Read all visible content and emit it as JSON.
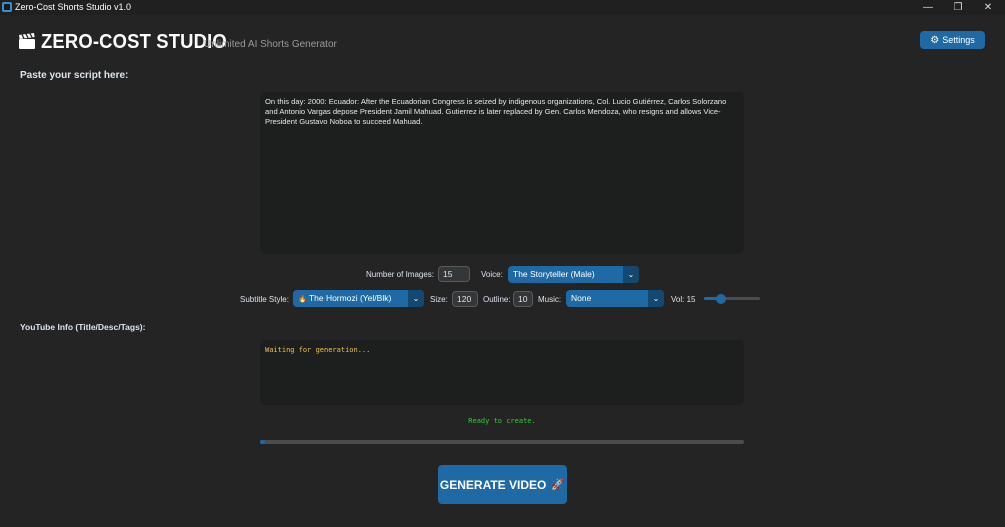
{
  "window": {
    "title": "Zero-Cost Shorts Studio v1.0",
    "min_glyph": "—",
    "restore_glyph": "❐",
    "close_glyph": "✕"
  },
  "header": {
    "brand": "ZERO-COST STUDIO",
    "tagline": "Unlimited AI Shorts Generator",
    "settings_label": "Settings",
    "settings_icon": "gear-icon",
    "logo_icon": "clapperboard-icon"
  },
  "script": {
    "label": "Paste your script here:",
    "text": "On this day: 2000: Ecuador: After the Ecuadorian Congress is seized by indigenous organizations, Col. Lucio Gutiérrez, Carlos Solorzano and Antonio Vargas depose President Jamil Mahuad. Gutierrez is later replaced by Gen. Carlos Mendoza, who resigns and allows Vice-President Gustavo Noboa to succeed Mahuad."
  },
  "controls": {
    "num_images_label": "Number of Images:",
    "num_images_value": "15",
    "voice_label": "Voice:",
    "voice_value": "The Storyteller (Male)",
    "subtitle_label": "Subtitle Style:",
    "subtitle_value": "The Hormozi (Yel/Blk)",
    "subtitle_icon": "fire-icon",
    "size_label": "Size:",
    "size_value": "120",
    "outline_label": "Outline:",
    "outline_value": "10",
    "music_label": "Music:",
    "music_value": "None",
    "vol_label": "Vol: 15",
    "vol_fraction": 0.3
  },
  "youtube": {
    "label": "YouTube Info (Title/Desc/Tags):",
    "text": "Waiting for generation..."
  },
  "status": {
    "text": "Ready to create.",
    "progress_fraction": 0.01
  },
  "generate": {
    "label": "GENERATE VIDEO",
    "icon": "rocket-icon"
  },
  "colors": {
    "accent": "#1f6aa5",
    "background": "#242424",
    "status_green": "#33cc33",
    "waiting_yellow": "#f0c24b"
  }
}
